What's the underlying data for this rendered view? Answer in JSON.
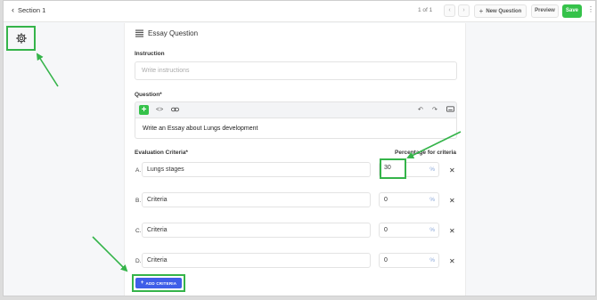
{
  "header": {
    "back_label": "Section 1",
    "counter": "1 of 1",
    "prev_icon": "chevron-left",
    "next_icon": "chevron-right",
    "new_question_label": "New Question",
    "preview_label": "Preview",
    "save_label": "Save"
  },
  "question": {
    "type_label": "Essay Question",
    "instruction_label": "Instruction",
    "instruction_placeholder": "Write instructions",
    "question_label": "Question*",
    "question_text": "Write an Essay about Lungs development"
  },
  "criteria": {
    "label": "Evaluation Criteria*",
    "percentage_label": "Percentage for criteria",
    "pct_symbol": "%",
    "rows": [
      {
        "letter": "A.",
        "text": "Lungs stages",
        "percent": "30"
      },
      {
        "letter": "B.",
        "text": "Criteria",
        "percent": "0"
      },
      {
        "letter": "C.",
        "text": "Criteria",
        "percent": "0"
      },
      {
        "letter": "D.",
        "text": "Criteria",
        "percent": "0"
      }
    ],
    "add_label": "ADD CRITERIA"
  },
  "colors": {
    "accent_green": "#35c24a",
    "annotation_green": "#35b44a",
    "primary_blue": "#3f5ee8"
  }
}
